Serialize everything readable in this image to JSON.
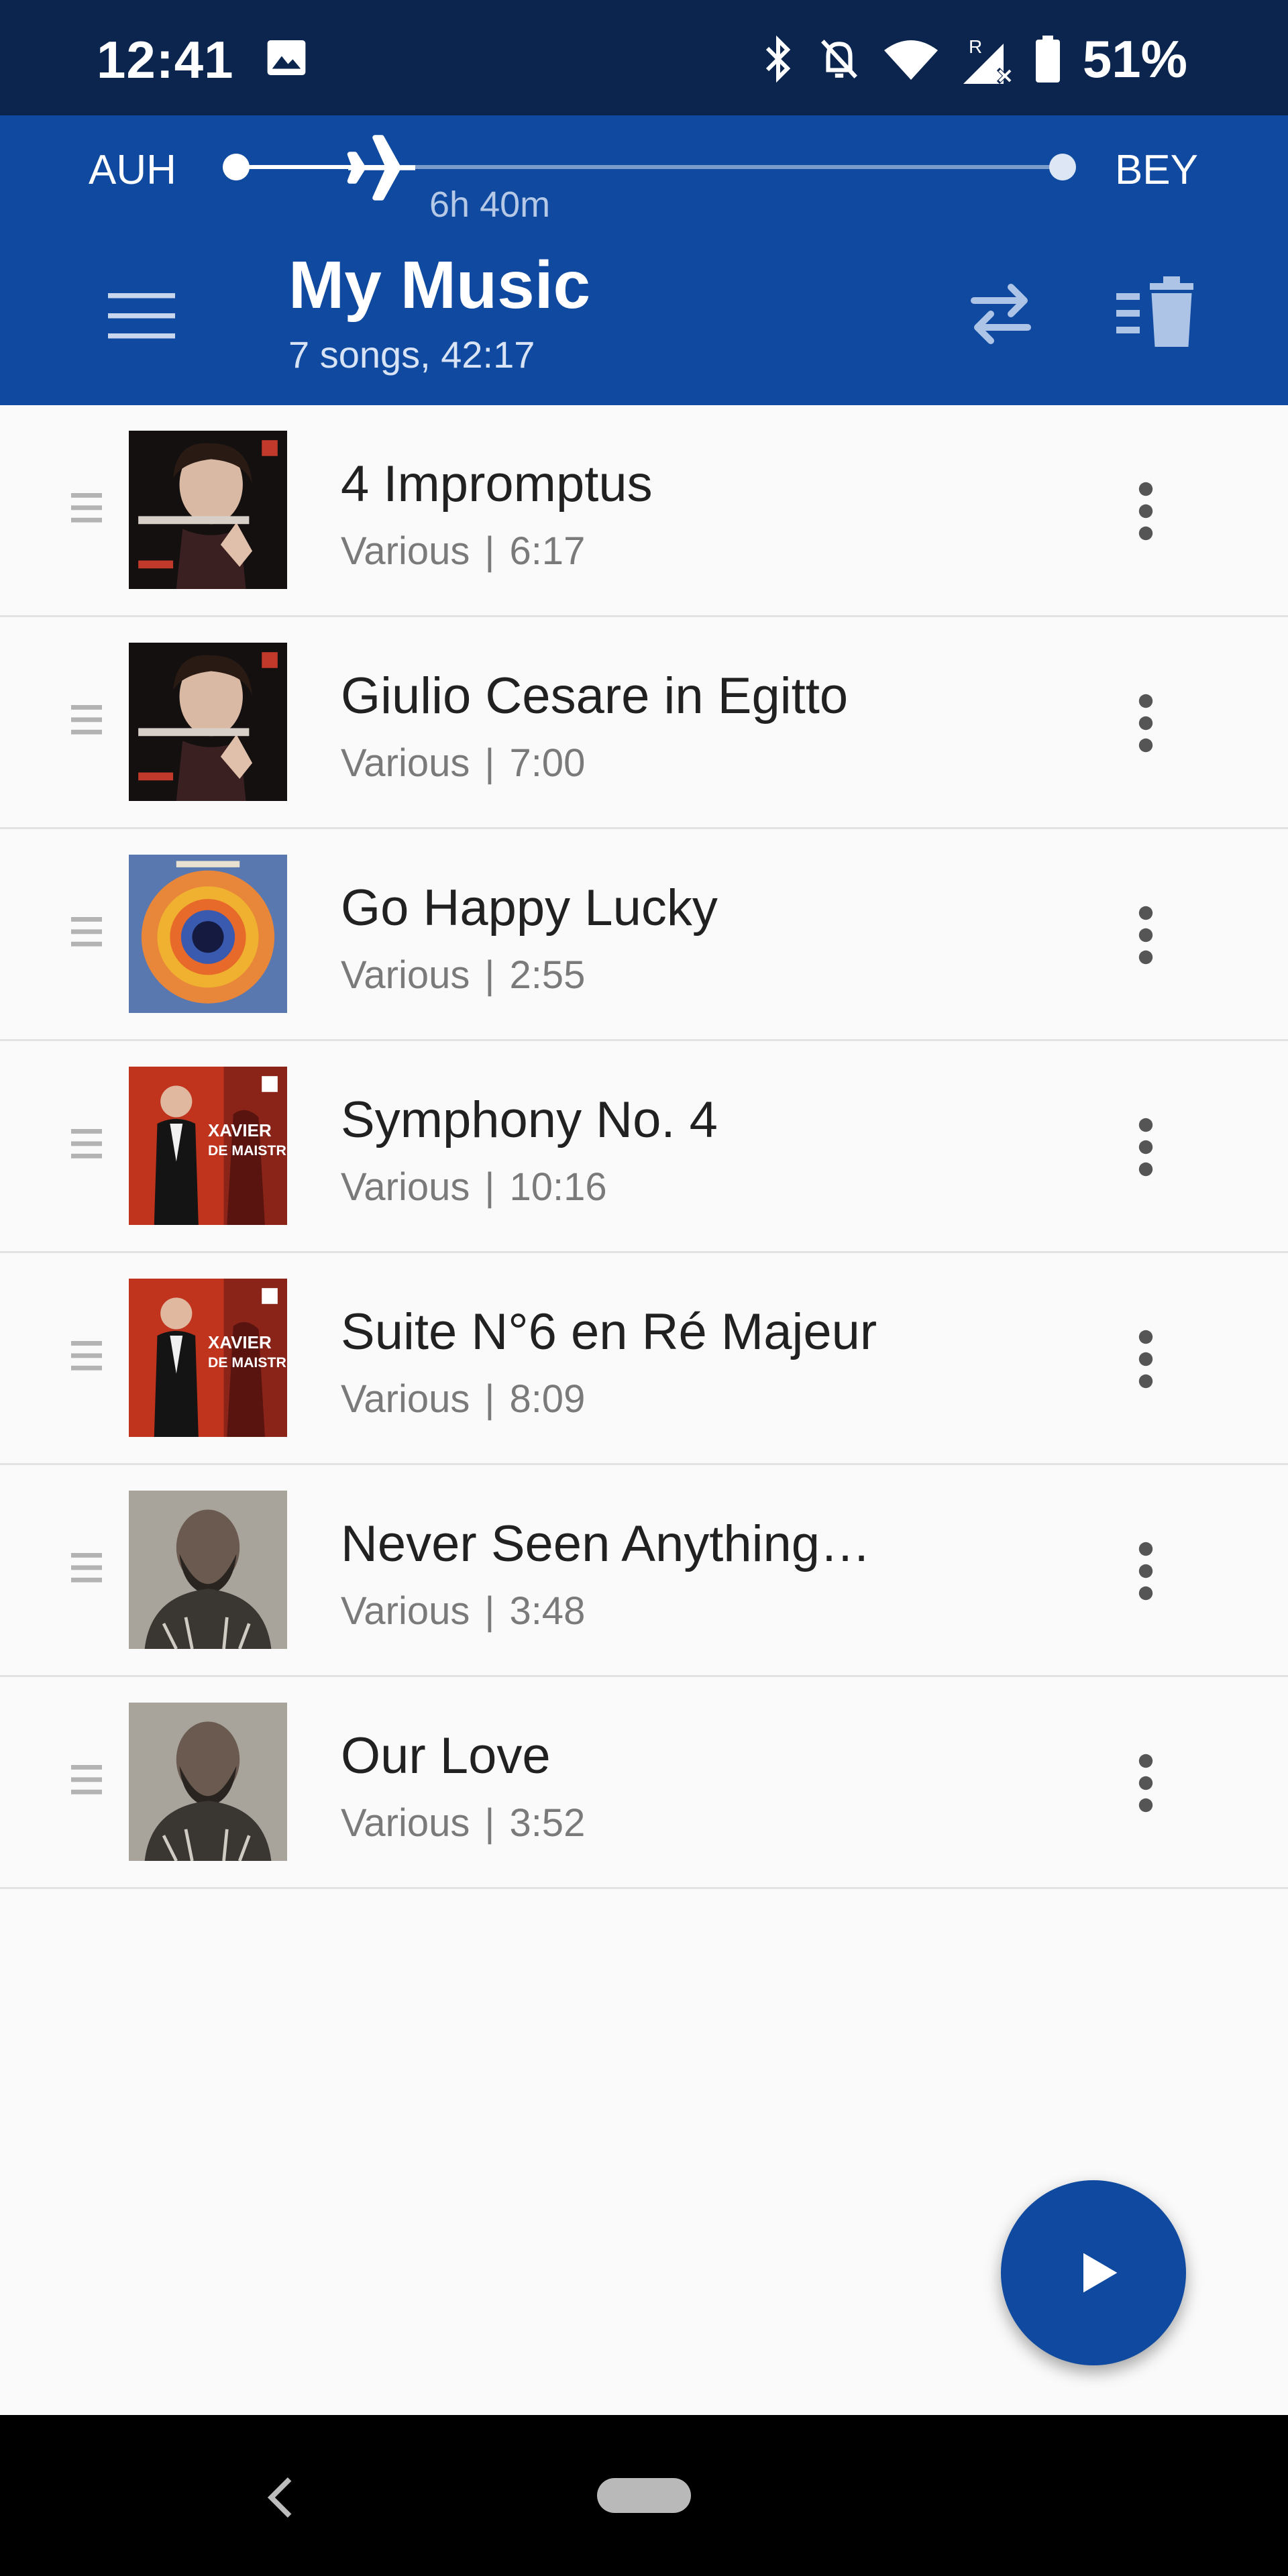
{
  "status": {
    "time": "12:41",
    "battery": "51%"
  },
  "flight": {
    "origin": "AUH",
    "destination": "BEY",
    "duration": "6h 40m",
    "progress": 0.2
  },
  "header": {
    "title": "My Music",
    "subtitle": "7 songs, 42:17"
  },
  "songs": [
    {
      "title": "4 Impromptus",
      "artist": "Various",
      "duration": "6:17",
      "cover": "olga"
    },
    {
      "title": "Giulio Cesare in Egitto",
      "artist": "Various",
      "duration": "7:00",
      "cover": "olga"
    },
    {
      "title": "Go Happy Lucky",
      "artist": "Various",
      "duration": "2:55",
      "cover": "rings"
    },
    {
      "title": "Symphony No. 4",
      "artist": "Various",
      "duration": "10:16",
      "cover": "xavier"
    },
    {
      "title": "Suite N°6 en Ré Majeur",
      "artist": "Various",
      "duration": "8:09",
      "cover": "xavier"
    },
    {
      "title": "Never Seen Anything…",
      "artist": "Various",
      "duration": "3:48",
      "cover": "man"
    },
    {
      "title": "Our Love",
      "artist": "Various",
      "duration": "3:52",
      "cover": "man"
    }
  ],
  "colors": {
    "status_bar": "#0b254f",
    "header": "#0f4aa0",
    "fab": "#0f4aa0"
  }
}
